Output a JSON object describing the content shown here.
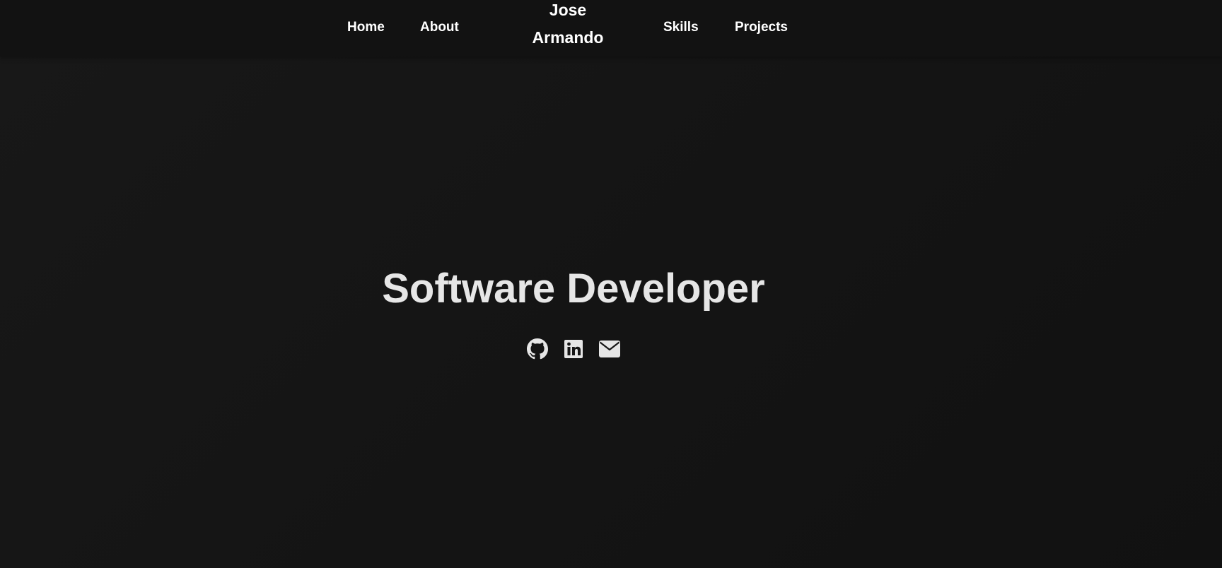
{
  "nav": {
    "home": "Home",
    "about": "About",
    "brand_first": "Jose",
    "brand_last": "Armando",
    "skills": "Skills",
    "projects": "Projects"
  },
  "hero": {
    "title": "Software Developer"
  },
  "social": {
    "icons": [
      "github-icon",
      "linkedin-icon",
      "email-icon"
    ]
  },
  "colors": {
    "background": "#161616",
    "navbar": "#121212",
    "nav_text": "#ffffff",
    "title_text": "#e6e6e6",
    "icon": "#e6e6e6"
  }
}
